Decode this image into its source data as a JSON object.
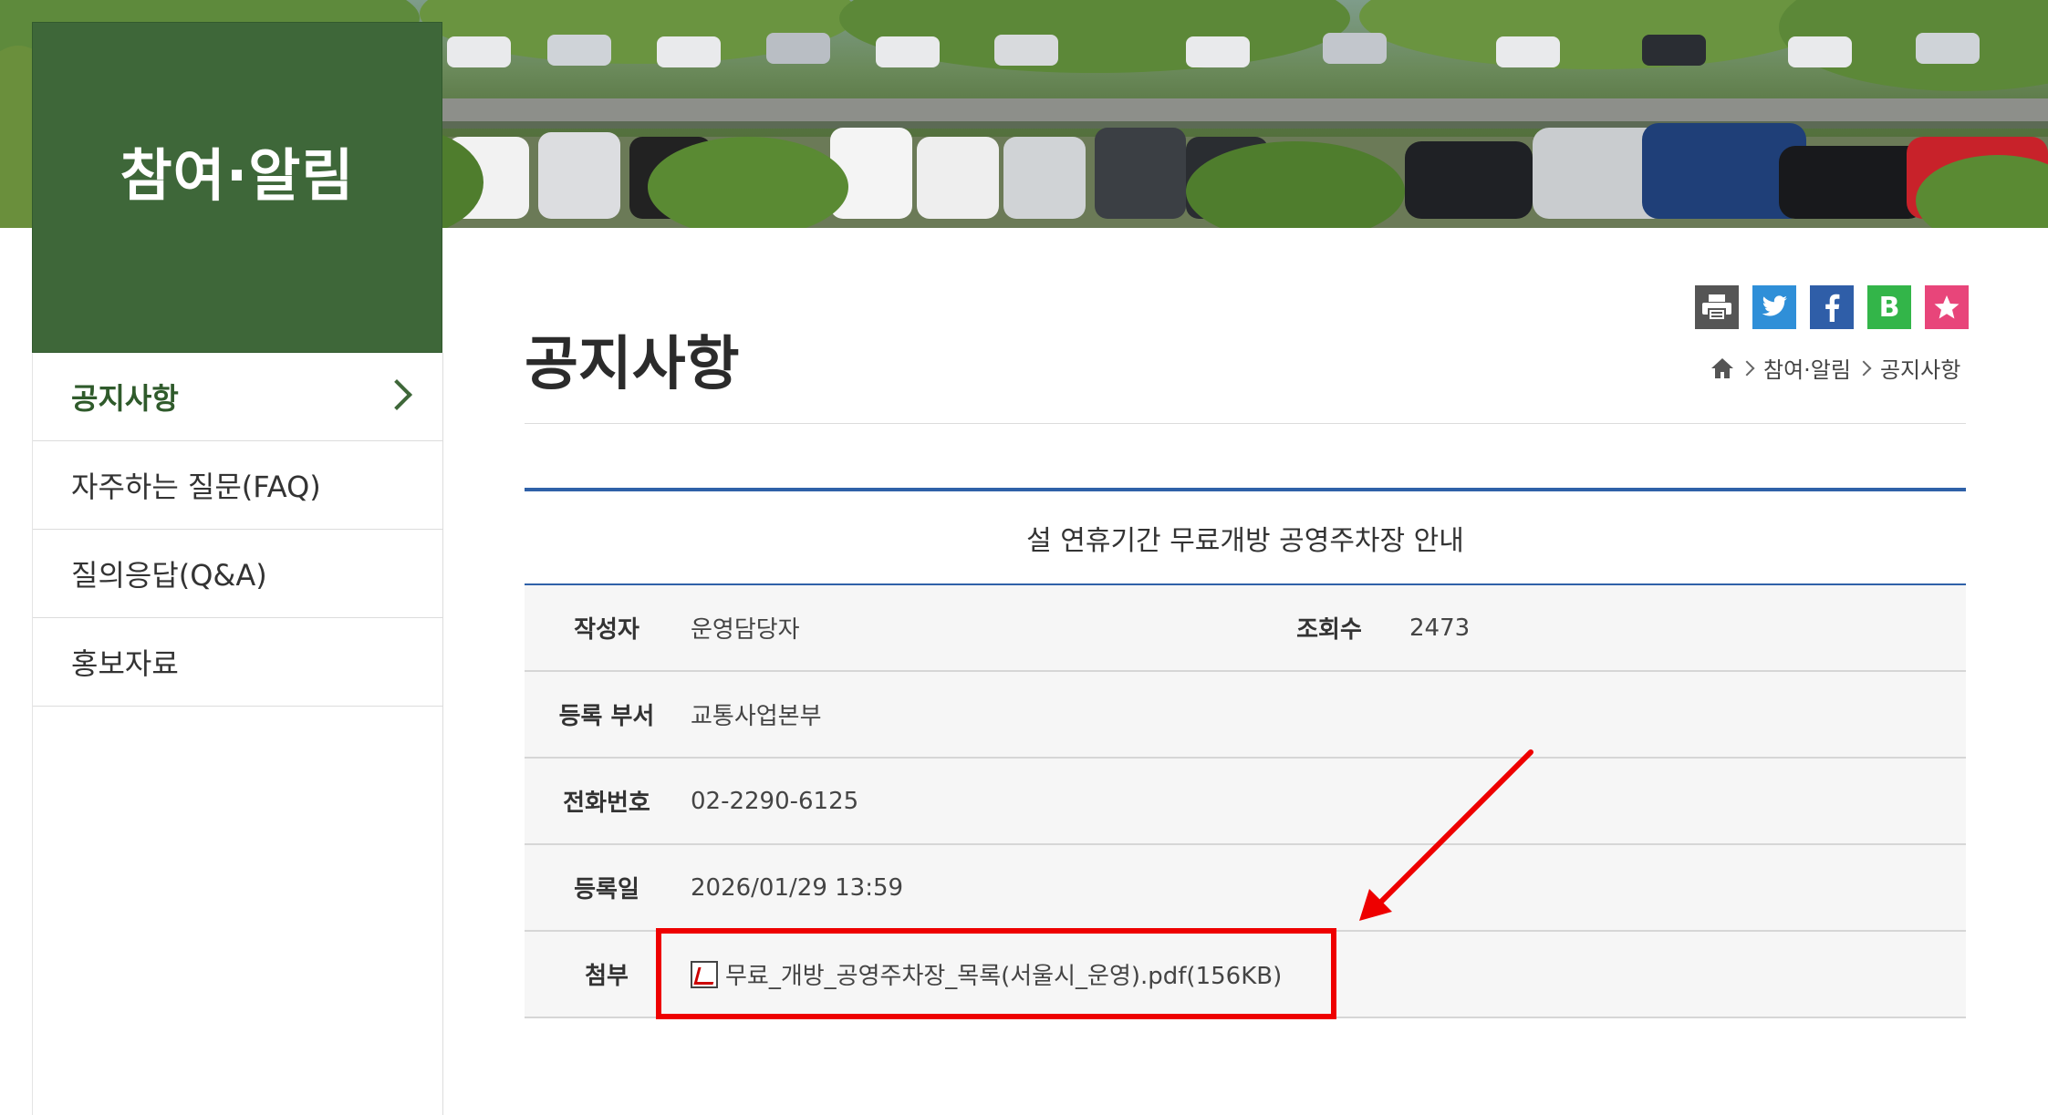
{
  "sidebar": {
    "title": "참여·알림",
    "items": [
      {
        "label": "공지사항",
        "active": true
      },
      {
        "label": "자주하는 질문(FAQ)",
        "active": false
      },
      {
        "label": "질의응답(Q&A)",
        "active": false
      },
      {
        "label": "홍보자료",
        "active": false
      }
    ]
  },
  "page": {
    "title": "공지사항",
    "breadcrumb": [
      "참여·알림",
      "공지사항"
    ]
  },
  "share": {
    "icons": [
      "print-icon",
      "twitter-icon",
      "facebook-icon",
      "blog-icon",
      "bookmark-star-icon"
    ],
    "colors": {
      "print": "#555555",
      "twitter": "#2f8fd8",
      "facebook": "#2f5ea8",
      "blog": "#33b549",
      "star": "#e8457a"
    },
    "blog_letter": "B"
  },
  "notice": {
    "subject": "설 연휴기간 무료개방 공영주차장 안내",
    "author_label": "작성자",
    "author": "운영담당자",
    "views_label": "조회수",
    "views": "2473",
    "dept_label": "등록 부서",
    "dept": "교통사업본부",
    "phone_label": "전화번호",
    "phone": "02-2290-6125",
    "date_label": "등록일",
    "date": "2026/01/29 13:59",
    "attach_label": "첨부",
    "attachment": "무료_개방_공영주차장_목록(서울시_운영).pdf(156KB)"
  },
  "colors": {
    "brand_green": "#3e6739",
    "accent_blue": "#2f61a8",
    "highlight_red": "#ee0000"
  }
}
